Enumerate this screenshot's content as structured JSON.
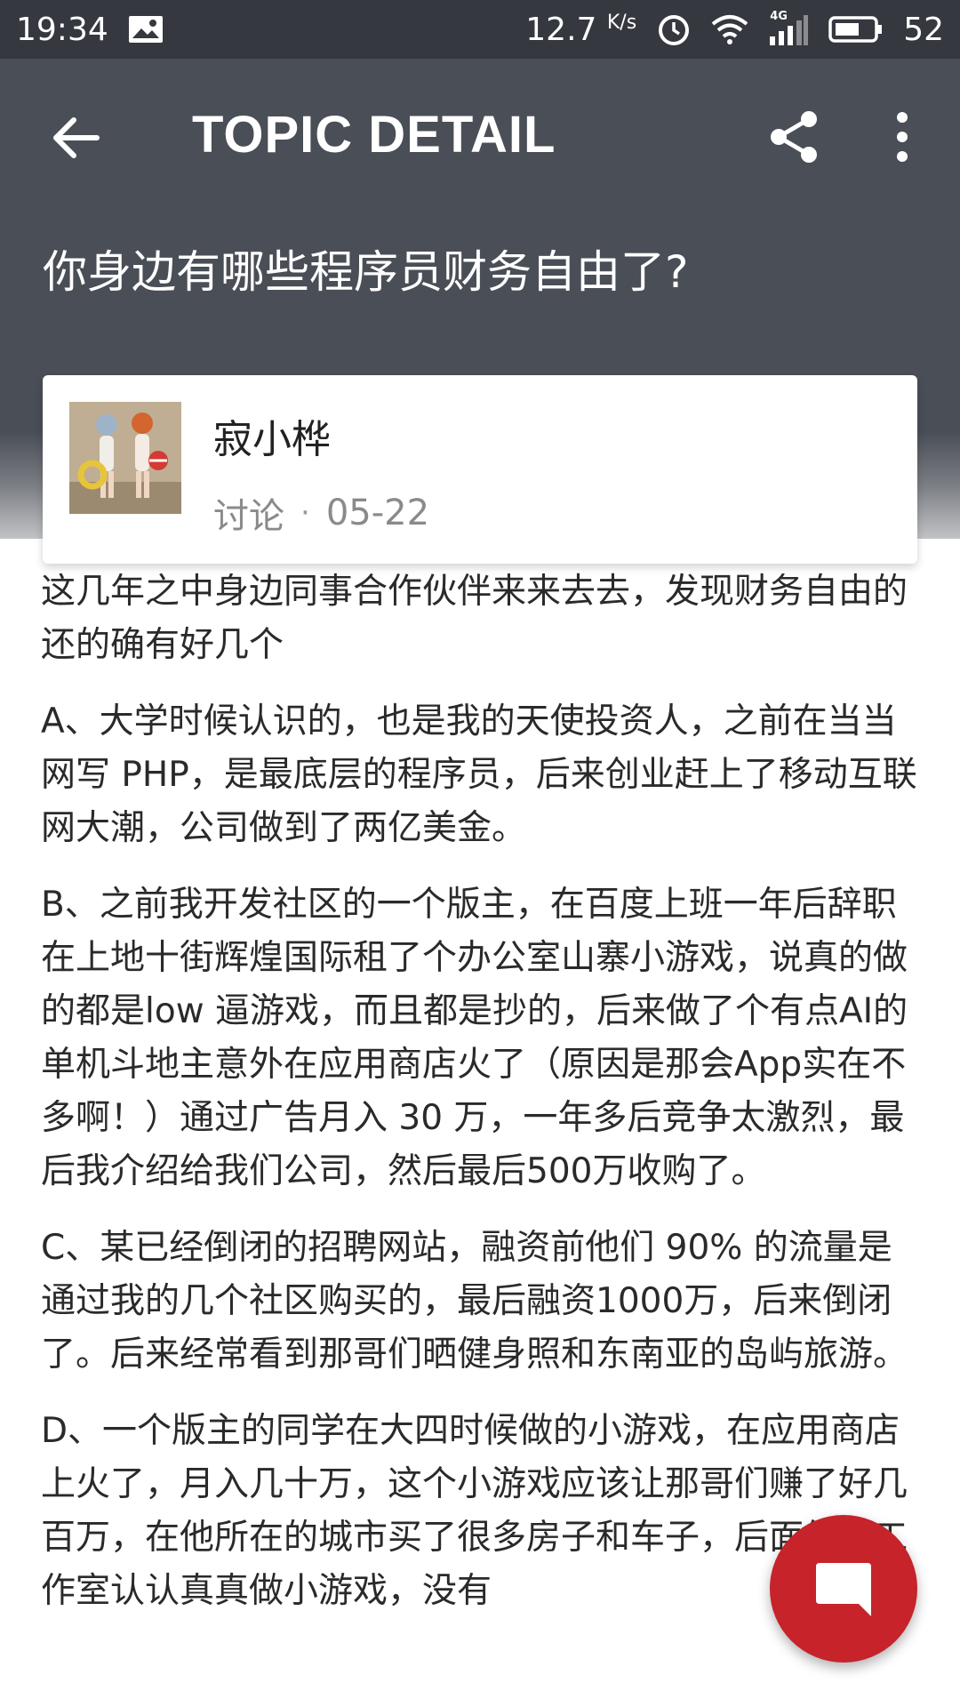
{
  "status_bar": {
    "time": "19:34",
    "speed_value": "12.7",
    "speed_unit": "K/s",
    "network": "4G",
    "battery": "52",
    "icons": [
      "image-icon",
      "alarm-icon",
      "wifi-icon",
      "signal-icon",
      "battery-icon"
    ]
  },
  "toolbar": {
    "title": "TOPIC DETAIL",
    "back_icon": "arrow-left-icon",
    "share_icon": "share-icon",
    "more_icon": "more-vertical-icon"
  },
  "topic": {
    "title": "你身边有哪些程序员财务自由了?"
  },
  "author": {
    "name": "寂小桦",
    "category": "讨论",
    "separator": "·",
    "date": "05-22"
  },
  "content": {
    "paragraphs": [
      "这几年之中身边同事合作伙伴来来去去，发现财务自由的还的确有好几个",
      "A、大学时候认识的，也是我的天使投资人，之前在当当网写 PHP，是最底层的程序员，后来创业赶上了移动互联网大潮，公司做到了两亿美金。",
      "B、之前我开发社区的一个版主，在百度上班一年后辞职在上地十街辉煌国际租了个办公室山寨小游戏，说真的做的都是low 逼游戏，而且都是抄的，后来做了个有点AI的单机斗地主意外在应用商店火了（原因是那会App实在不多啊！）通过广告月入 30 万，一年多后竞争太激烈，最后我介绍给我们公司，然后最后500万收购了。",
      "C、某已经倒闭的招聘网站，融资前他们 90% 的流量是通过我的几个社区购买的，最后融资1000万，后来倒闭了。后来经常看到那哥们晒健身照和东南亚的岛屿旅游。",
      "D、一个版主的同学在大四时候做的小游戏，在应用商店上火了，月入几十万，这个小游戏应该让那哥们赚了好几百万，在他所在的城市买了很多房子和车子，后面组建工作室认认真真做小游戏，没有"
    ]
  },
  "fab": {
    "icon": "chat-bubble-icon",
    "color": "#c6232a"
  }
}
